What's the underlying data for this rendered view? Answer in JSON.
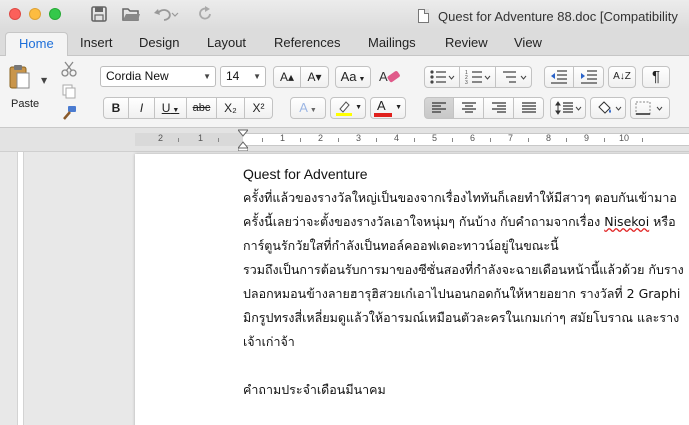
{
  "window": {
    "title": "Quest for Adventure 88.doc [Compatibility"
  },
  "tabs": [
    {
      "label": "Home",
      "active": true
    },
    {
      "label": "Insert"
    },
    {
      "label": "Design"
    },
    {
      "label": "Layout"
    },
    {
      "label": "References"
    },
    {
      "label": "Mailings"
    },
    {
      "label": "Review"
    },
    {
      "label": "View"
    }
  ],
  "ribbon": {
    "paste_label": "Paste",
    "font_name": "Cordia New",
    "font_size": "14",
    "bold": "B",
    "italic": "I",
    "underline": "U",
    "strikethrough": "abc",
    "subscript": "X₂",
    "superscript": "X²",
    "grow_font": "A▴",
    "shrink_font": "A▾",
    "change_case": "Aa",
    "text_effects": "A",
    "font_color": "A",
    "highlight_color": "#ffff00",
    "font_color_value": "#e0201c",
    "sort": "A↓Z",
    "show_marks": "¶"
  },
  "ruler": {
    "numbers": [
      "2",
      "1",
      "1",
      "2",
      "3",
      "4",
      "5",
      "6",
      "7",
      "8",
      "9",
      "10"
    ]
  },
  "document": {
    "lines": [
      {
        "text": "Quest for Adventure",
        "type": "title"
      },
      {
        "text": "ครั้งที่แล้วของรางวัลใหญ่เป็นของจากเรื่องไททันก็เลยทำให้มีสาวๆ ตอบกันเข้ามาอ"
      },
      {
        "pre": "ครั้งนี้เลยว่าจะตั้งของรางวัลเอาใจหนุ่มๆ กันบ้าง กับคำถามจากเรื่อง ",
        "misspelled": "Nisekoi",
        "post": " หรือ"
      },
      {
        "text": "การ์ตูนรักวัยใสที่กำลังเป็นทอล์คออฟเดอะทาวน์อยู่ในขณะนี้"
      },
      {
        "text": "รวมถึงเป็นการต้อนรับการมาของซีซั่นสองที่กำลังจะฉายเดือนหน้านี้แล้วด้วย กับราง"
      },
      {
        "text": "ปลอกหมอนข้างลายฮารุฮิสวยเก๋เอาไปนอนกอดกันให้หายอยาก รางวัลที่ 2 Graphi"
      },
      {
        "text": "มิกรูปทรงสี่เหลี่ยมดูแล้วให้อารมณ์เหมือนตัวละครในเกมเก่าๆ สมัยโบราณ และราง"
      },
      {
        "text": "เจ้าเก่าจ้า"
      },
      {
        "text": ""
      },
      {
        "text": "คำถามประจำเดือนมีนาคม"
      }
    ]
  }
}
